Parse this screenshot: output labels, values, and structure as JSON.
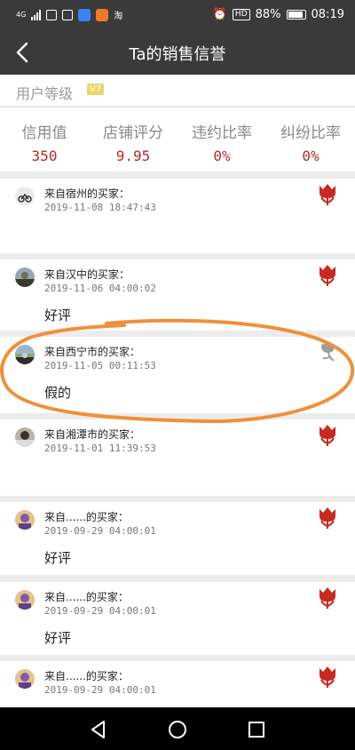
{
  "status_bar": {
    "network": "4G",
    "battery_percent": "88%",
    "time": "08:19",
    "hd_label": "HD"
  },
  "header": {
    "title": "Ta的销售信誉"
  },
  "user_level": {
    "label": "用户等级",
    "badge": "V7"
  },
  "stats": [
    {
      "label": "信用值",
      "value": "350"
    },
    {
      "label": "店铺评分",
      "value": "9.95"
    },
    {
      "label": "违约比率",
      "value": "0%"
    },
    {
      "label": "纠纷比率",
      "value": "0%"
    }
  ],
  "reviews": [
    {
      "buyer": "来自宿州的买家：",
      "time": "2019-11-08  18:47:43",
      "content": "",
      "rating": "good",
      "avatar_icon": "motorcycle-avatar"
    },
    {
      "buyer": "来自汉中的买家：",
      "time": "2019-11-06  04:00:02",
      "content": "好评",
      "rating": "good",
      "avatar_icon": "person-avatar"
    },
    {
      "buyer": "来自西宁市的买家：",
      "time": "2019-11-05  00:11:53",
      "content": "假的",
      "rating": "bad",
      "avatar_icon": "landscape-avatar"
    },
    {
      "buyer": "来自湘潭市的买家：",
      "time": "2019-11-01  11:39:53",
      "content": "",
      "rating": "good",
      "avatar_icon": "person-avatar"
    },
    {
      "buyer": "来自......的买家：",
      "time": "2019-09-29  04:00:01",
      "content": "好评",
      "rating": "good",
      "avatar_icon": "cartoon-avatar"
    },
    {
      "buyer": "来自......的买家：",
      "time": "2019-09-29  04:00:01",
      "content": "好评",
      "rating": "good",
      "avatar_icon": "cartoon-avatar"
    },
    {
      "buyer": "来自......的买家：",
      "time": "2019-09-29  04:00:01",
      "content": "",
      "rating": "good",
      "avatar_icon": "cartoon-avatar"
    }
  ],
  "colors": {
    "accent_red": "#b52a2a",
    "flower_red": "#c62a22",
    "flower_gray": "#9e9e9e",
    "annotation_orange": "#f0903a",
    "header_bg": "#3a3a3a"
  }
}
